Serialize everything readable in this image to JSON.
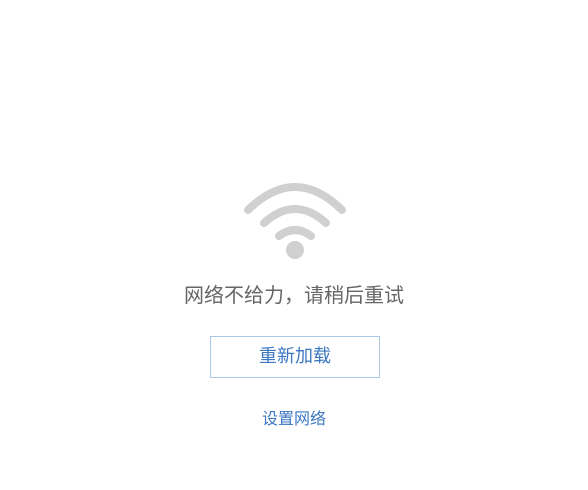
{
  "error": {
    "message": "网络不给力，请稍后重试",
    "icon": "wifi-icon"
  },
  "actions": {
    "reload_label": "重新加载",
    "settings_label": "设置网络"
  },
  "colors": {
    "icon": "#d0d0d0",
    "message_text": "#666666",
    "link": "#3b77c3",
    "button_border": "#a9c8e6",
    "background": "#ffffff"
  }
}
